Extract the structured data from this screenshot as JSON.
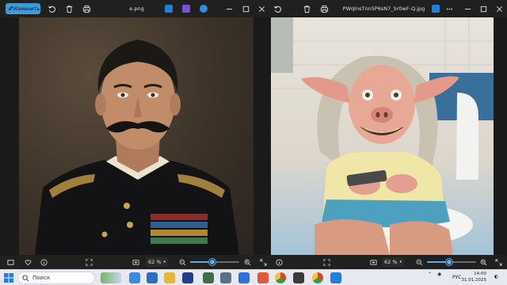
{
  "windows": [
    {
      "filename": "e.png",
      "edit_label": "Изменить",
      "zoom": "62 %",
      "zoom_fraction": 0.45
    },
    {
      "filename": "PWqlnsTnn5P6sN7_Sr0wF-Q.jpg",
      "zoom": "62 %",
      "zoom_fraction": 0.45
    }
  ],
  "taskbar": {
    "search_placeholder": "Поиск",
    "language": "РУС",
    "time": "14:00",
    "date": "31.01.2025"
  },
  "colors": {
    "accent": "#3c9bd8",
    "slider": "#5ab0ee",
    "window_bg": "#202020"
  },
  "icons": [
    "rotate-icon",
    "delete-icon",
    "print-icon",
    "edit-icon",
    "more-icon",
    "heart-icon",
    "info-icon",
    "fit-icon",
    "zoom-out-icon",
    "zoom-in-icon",
    "fullscreen-icon",
    "start-icon",
    "search-icon"
  ]
}
